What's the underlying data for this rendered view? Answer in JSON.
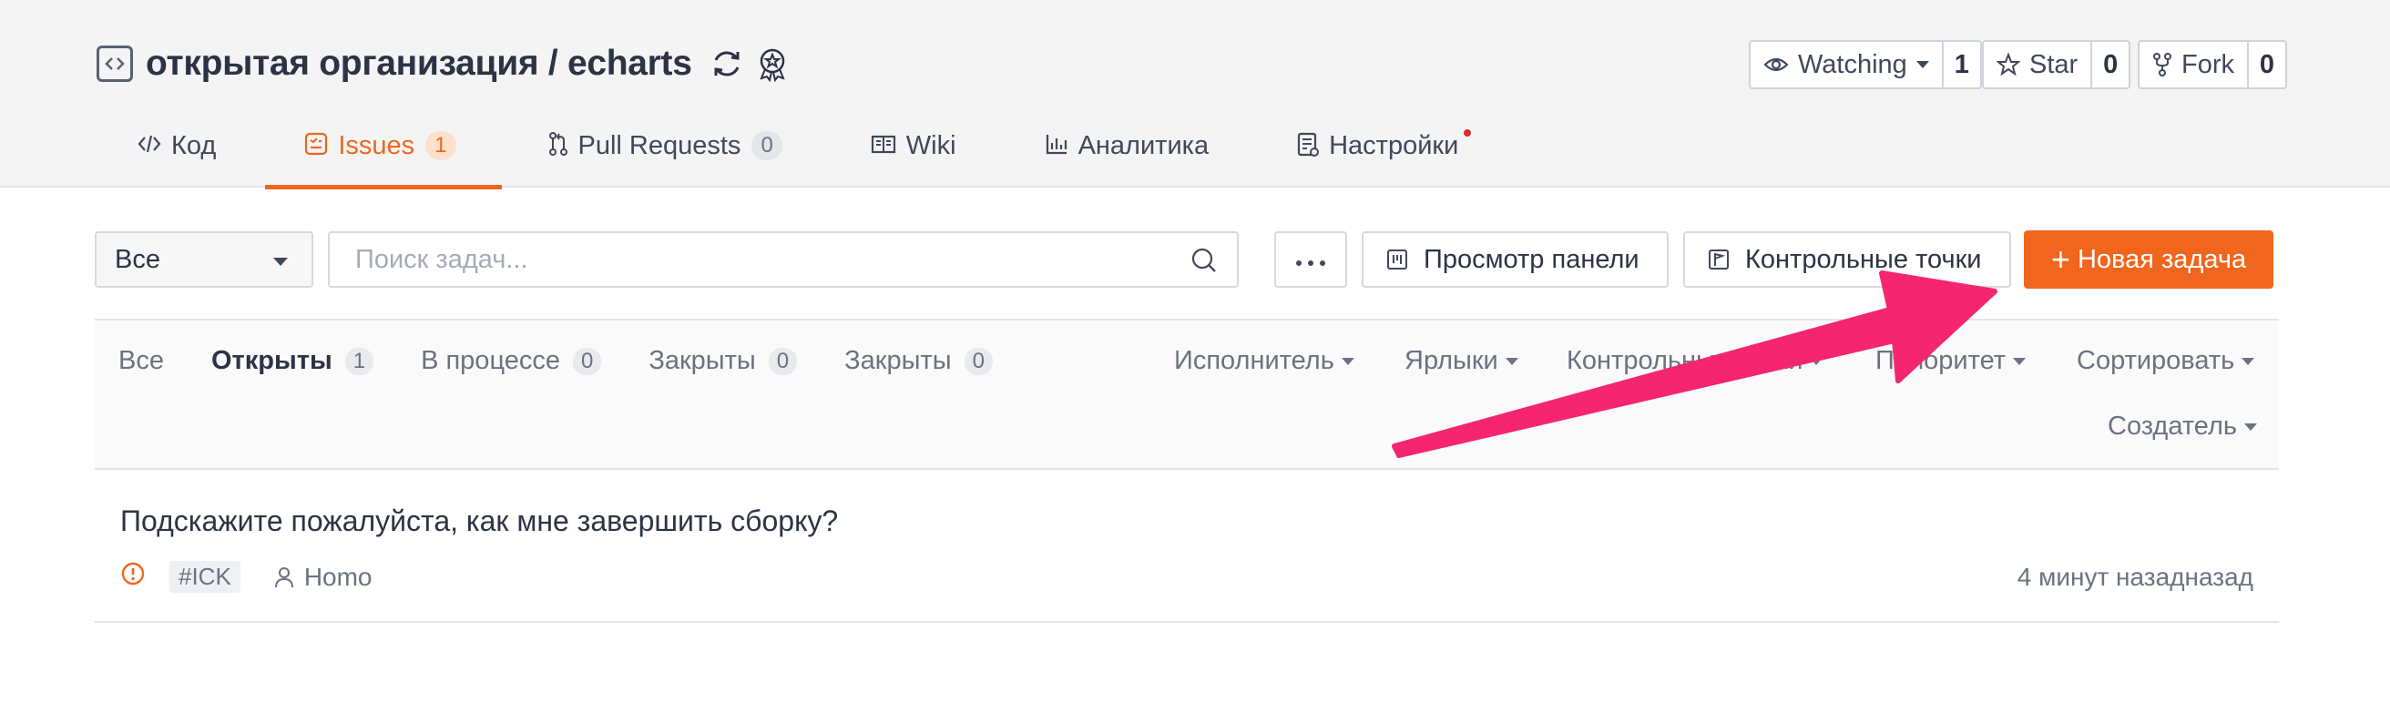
{
  "repo": {
    "org": "открытая организация",
    "separator": " / ",
    "name": "echarts",
    "full": "открытая организация / echarts"
  },
  "actions": {
    "watch": {
      "label": "Watching",
      "count": "1"
    },
    "star": {
      "label": "Star",
      "count": "0"
    },
    "fork": {
      "label": "Fork",
      "count": "0"
    }
  },
  "tabs": [
    {
      "label": "Код",
      "icon": "code-icon"
    },
    {
      "label": "Issues",
      "badge": "1",
      "icon": "issues-icon",
      "active": true
    },
    {
      "label": "Pull Requests",
      "badge": "0",
      "icon": "pull-request-icon"
    },
    {
      "label": "Wiki",
      "icon": "book-icon"
    },
    {
      "label": "Аналитика",
      "icon": "bar-chart-icon"
    },
    {
      "label": "Настройки",
      "icon": "settings-doc-icon",
      "notification_dot": true
    }
  ],
  "filter": {
    "select_value": "Все",
    "search_placeholder": "Поиск задач...",
    "board_view": "Просмотр панели",
    "milestones": "Контрольные точки",
    "new_issue": "Новая задача"
  },
  "status_tabs": [
    {
      "label": "Все"
    },
    {
      "label": "Открыты",
      "badge": "1",
      "active": true
    },
    {
      "label": "В процессе",
      "badge": "0"
    },
    {
      "label": "Закрыты",
      "badge": "0"
    },
    {
      "label": "Закрыты",
      "badge": "0"
    }
  ],
  "filters": {
    "assignee": "Исполнитель",
    "labels": "Ярлыки",
    "milestones": "Контрольные точки",
    "priority": "Приоритет",
    "sort": "Сортировать",
    "creator": "Создатель"
  },
  "issues": [
    {
      "title": "Подскажите пожалуйста, как мне завершить сборку?",
      "id": "#ICK",
      "author": "Homo",
      "time": "4 минут назадназад"
    }
  ],
  "colors": {
    "accent": "#f0661f",
    "annotation_arrow": "#f5256f",
    "header_bg": "#f4f4f4"
  }
}
